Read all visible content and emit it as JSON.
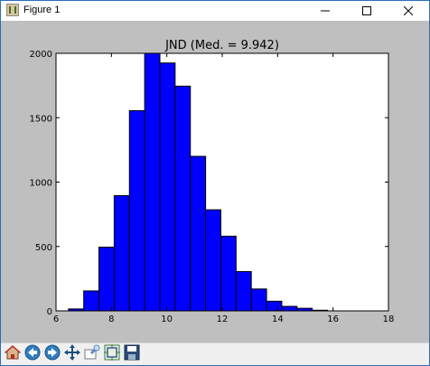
{
  "window": {
    "title": "Figure 1",
    "minimize_icon": "minimize-icon",
    "maximize_icon": "maximize-icon",
    "close_icon": "close-icon"
  },
  "toolbar": {
    "buttons": [
      {
        "name": "home",
        "icon": "home-icon"
      },
      {
        "name": "back",
        "icon": "back-arrow-icon"
      },
      {
        "name": "forward",
        "icon": "forward-arrow-icon"
      },
      {
        "name": "pan",
        "icon": "pan-move-icon"
      },
      {
        "name": "zoom",
        "icon": "zoom-rect-icon"
      },
      {
        "name": "configure-subplots",
        "icon": "subplots-icon"
      },
      {
        "name": "save",
        "icon": "save-disk-icon"
      }
    ]
  },
  "chart_data": {
    "type": "bar",
    "title": "JND (Med. = 9.942)",
    "xlabel": "",
    "ylabel": "",
    "xlim": [
      6,
      18
    ],
    "ylim": [
      0,
      2000
    ],
    "xticks": [
      "6",
      "8",
      "10",
      "12",
      "14",
      "16",
      "18"
    ],
    "yticks": [
      "0",
      "500",
      "1000",
      "1500",
      "2000"
    ],
    "bin_edges": [
      6.45,
      7.0,
      7.55,
      8.1,
      8.65,
      9.2,
      9.75,
      10.3,
      10.85,
      11.4,
      11.95,
      12.5,
      13.05,
      13.6,
      14.15,
      14.7,
      15.25,
      15.8
    ],
    "values": [
      15,
      155,
      495,
      895,
      1555,
      2000,
      1925,
      1745,
      1200,
      785,
      580,
      305,
      170,
      75,
      35,
      20,
      5
    ],
    "bar_color": "#0000ff",
    "grid": false
  }
}
